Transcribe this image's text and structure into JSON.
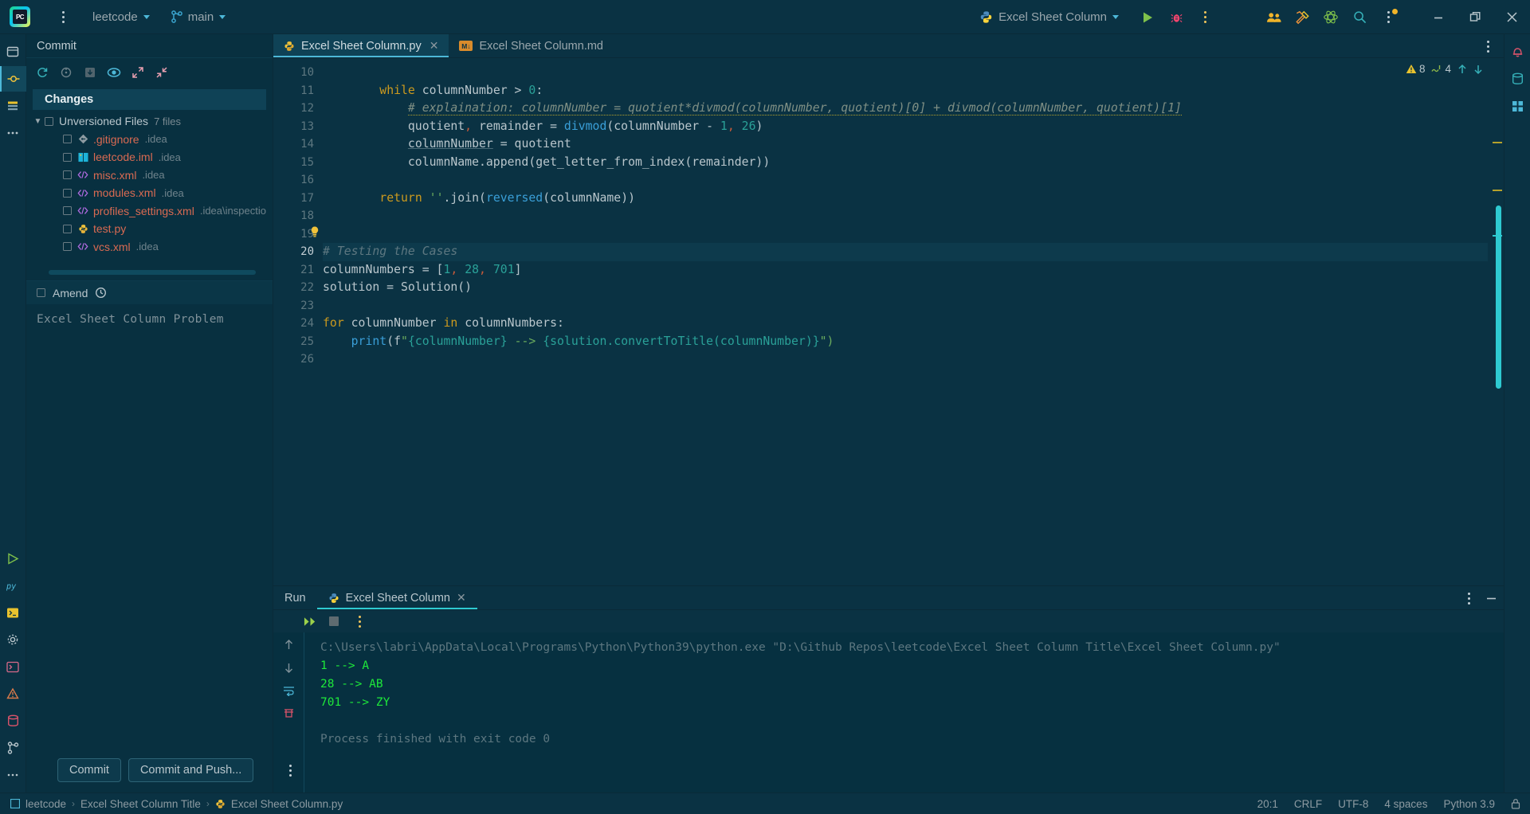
{
  "titlebar": {
    "logo_text": "PC",
    "project_name": "leetcode",
    "branch_name": "main",
    "run_config": "Excel Sheet Column",
    "icons": {
      "main_menu": "hamburger-menu-icon",
      "project_chevron": "chevron-down-icon",
      "branch": "git-branch-icon",
      "branch_chevron": "chevron-down-icon",
      "python_config": "python-icon",
      "config_chevron": "chevron-down-icon",
      "run": "run-play-icon",
      "debug": "debug-bug-icon",
      "more_run": "more-vertical-icon",
      "code_with_me": "code-with-me-users-icon",
      "tools": "tools-hammer-wrench-icon",
      "atom": "atom-science-icon",
      "search": "search-magnifier-icon",
      "notifications_more": "more-vertical-dot-icon",
      "minimize": "minimize-window-icon",
      "maximize": "maximize-window-icon",
      "close": "close-window-icon"
    }
  },
  "left_rail": {
    "items": [
      {
        "name": "project-tool-icon",
        "glyph": "project"
      },
      {
        "name": "commit-tool-icon",
        "glyph": "commit",
        "selected": true
      },
      {
        "name": "structure-tool-icon",
        "glyph": "structure"
      },
      {
        "name": "more-tool-windows-icon",
        "glyph": "dots"
      }
    ],
    "bottom_items": [
      {
        "name": "run-tool-icon",
        "glyph": "run"
      },
      {
        "name": "python-packages-icon",
        "glyph": "py"
      },
      {
        "name": "terminal-tool-icon",
        "glyph": "terminal"
      },
      {
        "name": "settings-gear-icon",
        "glyph": "gear"
      },
      {
        "name": "python-console-icon",
        "glyph": "pyconsole"
      },
      {
        "name": "problems-tool-icon",
        "glyph": "problems"
      },
      {
        "name": "database-tool-icon",
        "glyph": "db"
      },
      {
        "name": "git-tool-icon",
        "glyph": "git"
      },
      {
        "name": "more-rail-icon",
        "glyph": "moredots"
      }
    ]
  },
  "right_rail": {
    "items": [
      {
        "name": "notifications-bell-icon"
      },
      {
        "name": "database-right-icon"
      },
      {
        "name": "grid-right-icon"
      }
    ]
  },
  "commit_panel": {
    "title": "Commit",
    "toolbar": [
      {
        "name": "refresh-changes-icon"
      },
      {
        "name": "revert-rollback-icon"
      },
      {
        "name": "shelve-changes-icon"
      },
      {
        "name": "show-diff-preview-icon"
      },
      {
        "name": "expand-all-icon"
      },
      {
        "name": "collapse-all-icon"
      }
    ],
    "changes_label": "Changes",
    "group": {
      "label": "Unversioned Files",
      "count": "7 files",
      "expanded": true
    },
    "files": [
      {
        "name": ".gitignore",
        "path": ".idea",
        "icon": "gitignore-icon"
      },
      {
        "name": "leetcode.iml",
        "path": ".idea",
        "icon": "iml-module-icon"
      },
      {
        "name": "misc.xml",
        "path": ".idea",
        "icon": "xml-file-icon"
      },
      {
        "name": "modules.xml",
        "path": ".idea",
        "icon": "xml-file-icon"
      },
      {
        "name": "profiles_settings.xml",
        "path": ".idea\\inspectio",
        "icon": "xml-file-icon"
      },
      {
        "name": "test.py",
        "path": "",
        "icon": "python-file-icon"
      },
      {
        "name": "vcs.xml",
        "path": ".idea",
        "icon": "xml-file-icon"
      }
    ],
    "amend_label": "Amend",
    "amend_history_icon": "commit-history-clock-icon",
    "commit_message": "Excel Sheet Column Problem",
    "commit_button": "Commit",
    "commit_push_button": "Commit and Push...",
    "more_actions_icon": "more-vertical-icon"
  },
  "editor": {
    "tabs": [
      {
        "label": "Excel Sheet Column.py",
        "icon": "python-file-icon",
        "active": true,
        "closable": true
      },
      {
        "label": "Excel Sheet Column.md",
        "icon": "markdown-file-icon",
        "active": false,
        "closable": false
      }
    ],
    "tab_options_icon": "more-vertical-icon",
    "inspection_badges": {
      "warnings_icon": "warning-triangle-icon",
      "warnings_count": "8",
      "weak_warnings_icon": "weak-warning-icon",
      "weak_warnings_count": "4",
      "prev_icon": "arrow-up-icon",
      "next_icon": "arrow-down-icon"
    },
    "intention_bulb_icon": "intention-lightbulb-icon",
    "first_line_number": 10,
    "current_line": 20,
    "lines": [
      {
        "n": 10,
        "tokens": []
      },
      {
        "n": 11,
        "tokens": [
          {
            "t": "        ",
            "c": "op"
          },
          {
            "t": "while",
            "c": "kw"
          },
          {
            "t": " columnNumber ",
            "c": "op"
          },
          {
            "t": ">",
            "c": "op"
          },
          {
            "t": " ",
            "c": "op"
          },
          {
            "t": "0",
            "c": "num"
          },
          {
            "t": ":",
            "c": "op"
          }
        ]
      },
      {
        "n": 12,
        "tokens": [
          {
            "t": "            ",
            "c": "op"
          },
          {
            "t": "# explaination: columnNumber = quotient*divmod(columnNumber, quotient)[0] + divmod(columnNumber, quotient)[1]",
            "c": "cmt-warn"
          }
        ]
      },
      {
        "n": 13,
        "tokens": [
          {
            "t": "            quotient",
            "c": "op"
          },
          {
            "t": ",",
            "c": "punc"
          },
          {
            "t": " remainder = ",
            "c": "op"
          },
          {
            "t": "divmod",
            "c": "fn"
          },
          {
            "t": "(columnNumber - ",
            "c": "op"
          },
          {
            "t": "1",
            "c": "num"
          },
          {
            "t": ",",
            "c": "punc"
          },
          {
            "t": " ",
            "c": "op"
          },
          {
            "t": "26",
            "c": "num"
          },
          {
            "t": ")",
            "c": "op"
          }
        ]
      },
      {
        "n": 14,
        "tokens": [
          {
            "t": "            ",
            "c": "op"
          },
          {
            "t": "columnNumber",
            "c": "und"
          },
          {
            "t": " = quotient",
            "c": "op"
          }
        ]
      },
      {
        "n": 15,
        "tokens": [
          {
            "t": "            columnName.append(get_letter_from_index(remainder))",
            "c": "op"
          }
        ]
      },
      {
        "n": 16,
        "tokens": []
      },
      {
        "n": 17,
        "tokens": [
          {
            "t": "        ",
            "c": "op"
          },
          {
            "t": "return",
            "c": "kw"
          },
          {
            "t": " ",
            "c": "op"
          },
          {
            "t": "''",
            "c": "str"
          },
          {
            "t": ".join(",
            "c": "op"
          },
          {
            "t": "reversed",
            "c": "fn"
          },
          {
            "t": "(columnName))",
            "c": "op"
          }
        ]
      },
      {
        "n": 18,
        "tokens": []
      },
      {
        "n": 19,
        "tokens": []
      },
      {
        "n": 20,
        "highlight": true,
        "tokens": [
          {
            "t": "# Testing the Cases",
            "c": "cmt"
          }
        ]
      },
      {
        "n": 21,
        "tokens": [
          {
            "t": "columnNumbers = [",
            "c": "op"
          },
          {
            "t": "1",
            "c": "num"
          },
          {
            "t": ",",
            "c": "punc"
          },
          {
            "t": " ",
            "c": "op"
          },
          {
            "t": "28",
            "c": "num"
          },
          {
            "t": ",",
            "c": "punc"
          },
          {
            "t": " ",
            "c": "op"
          },
          {
            "t": "701",
            "c": "num"
          },
          {
            "t": "]",
            "c": "op"
          }
        ]
      },
      {
        "n": 22,
        "tokens": [
          {
            "t": "solution = Solution()",
            "c": "op"
          }
        ]
      },
      {
        "n": 23,
        "tokens": []
      },
      {
        "n": 24,
        "tokens": [
          {
            "t": "for",
            "c": "kw"
          },
          {
            "t": " columnNumber ",
            "c": "op"
          },
          {
            "t": "in",
            "c": "kw"
          },
          {
            "t": " columnNumbers:",
            "c": "op"
          }
        ]
      },
      {
        "n": 25,
        "tokens": [
          {
            "t": "    ",
            "c": "op"
          },
          {
            "t": "print",
            "c": "fn"
          },
          {
            "t": "(f",
            "c": "op"
          },
          {
            "t": "\"",
            "c": "str"
          },
          {
            "t": "{columnNumber}",
            "c": "num"
          },
          {
            "t": " --> ",
            "c": "str"
          },
          {
            "t": "{solution.convertToTitle(columnNumber)}",
            "c": "num"
          },
          {
            "t": "\")",
            "c": "str"
          }
        ]
      },
      {
        "n": 26,
        "tokens": []
      }
    ]
  },
  "run_panel": {
    "tabs": [
      {
        "label": "Run",
        "icon": null,
        "active": false
      },
      {
        "label": "Excel Sheet Column",
        "icon": "python-file-icon",
        "active": true,
        "closable": true
      }
    ],
    "panel_options_icon": "more-vertical-icon",
    "hide_icon": "minimize-panel-icon",
    "toolbar": [
      {
        "name": "rerun-fast-forward-icon"
      },
      {
        "name": "stop-process-icon"
      },
      {
        "name": "console-options-more-icon"
      }
    ],
    "side_toolbar": [
      {
        "name": "scroll-up-arrow-icon"
      },
      {
        "name": "scroll-down-arrow-icon"
      },
      {
        "name": "soft-wrap-icon"
      },
      {
        "name": "clear-console-icon"
      }
    ],
    "console_lines": [
      {
        "text": "C:\\Users\\labri\\AppData\\Local\\Programs\\Python\\Python39\\python.exe \"D:\\Github Repos\\leetcode\\Excel Sheet Column Title\\Excel Sheet Column.py\"",
        "style": "cmd"
      },
      {
        "text": "1 --> A",
        "style": "out"
      },
      {
        "text": "28 --> AB",
        "style": "out"
      },
      {
        "text": "701 --> ZY",
        "style": "out"
      },
      {
        "text": "",
        "style": "out"
      },
      {
        "text": "Process finished with exit code 0",
        "style": "fin"
      }
    ]
  },
  "statusbar": {
    "breadcrumbs": [
      {
        "label": "leetcode",
        "icon": "project-module-icon"
      },
      {
        "label": "Excel Sheet Column Title",
        "icon": null
      },
      {
        "label": "Excel Sheet Column.py",
        "icon": "python-file-icon"
      }
    ],
    "separator": "›",
    "caret_position": "20:1",
    "line_separator": "CRLF",
    "encoding": "UTF-8",
    "indent": "4 spaces",
    "interpreter": "Python 3.9",
    "lock_icon": "read-only-lock-icon"
  },
  "colors": {
    "bg": "#0a3243",
    "editor_bg": "#0a3243",
    "panel_bg": "#083040",
    "console_bg": "#063040",
    "accent": "#2ecad1",
    "accent_blue": "#4db8d8",
    "file_red": "#d96a52",
    "console_green": "#1ee83a",
    "keyword": "#cc9a1e",
    "number": "#2aa198",
    "function": "#3a9fd8",
    "string": "#6aab5e",
    "comment": "#5d7780"
  }
}
